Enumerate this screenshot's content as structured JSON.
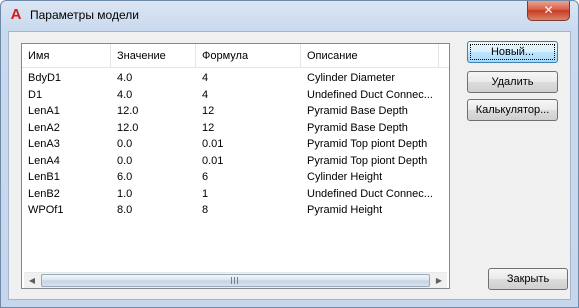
{
  "window": {
    "title": "Параметры модели",
    "app_icon": "A",
    "close_glyph": "✕"
  },
  "table": {
    "columns": [
      "Имя",
      "Значение",
      "Формула",
      "Описание"
    ],
    "rows": [
      [
        "BdyD1",
        "4.0",
        "4",
        "Cylinder Diameter"
      ],
      [
        "D1",
        "4.0",
        "4",
        "Undefined Duct Connec..."
      ],
      [
        "LenA1",
        "12.0",
        "12",
        "Pyramid Base Depth"
      ],
      [
        "LenA2",
        "12.0",
        "12",
        "Pyramid Base Depth"
      ],
      [
        "LenA3",
        "0.0",
        "0.01",
        "Pyramid Top piont Depth"
      ],
      [
        "LenA4",
        "0.0",
        "0.01",
        "Pyramid Top piont Depth"
      ],
      [
        "LenB1",
        "6.0",
        "6",
        "Cylinder Height"
      ],
      [
        "LenB2",
        "1.0",
        "1",
        "Undefined Duct Connec..."
      ],
      [
        "WPOf1",
        "8.0",
        "8",
        "Pyramid Height"
      ]
    ]
  },
  "scrollbar": {
    "left_arrow": "◀",
    "right_arrow": "▶"
  },
  "buttons": {
    "new": "Новый...",
    "delete": "Удалить",
    "calculator": "Калькулятор...",
    "close": "Закрыть"
  }
}
